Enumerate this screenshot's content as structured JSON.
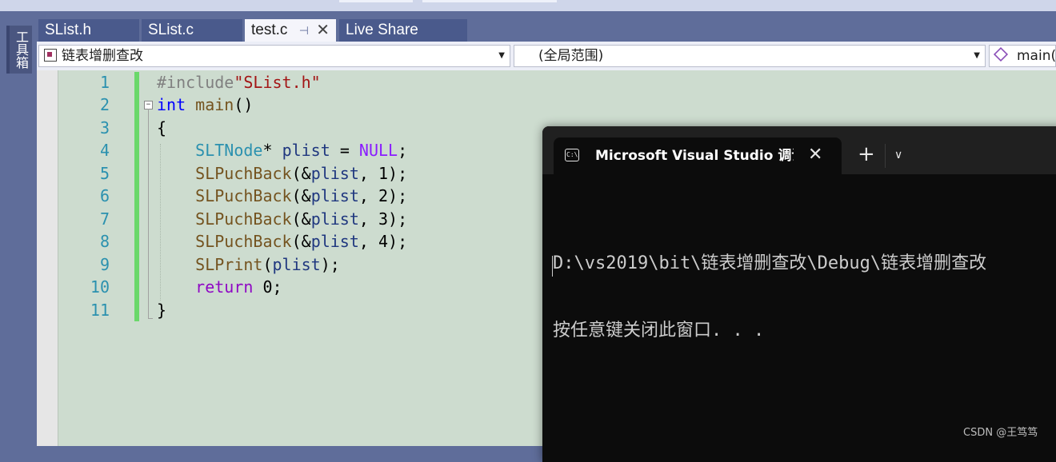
{
  "sidebar": {
    "toolbox_label": "工具箱"
  },
  "tabs": [
    {
      "label": "SList.h",
      "active": false
    },
    {
      "label": "SList.c",
      "active": false
    },
    {
      "label": "test.c",
      "active": true,
      "pin": "⊣",
      "close": "✕"
    },
    {
      "label": "Live Share",
      "active": false
    }
  ],
  "navbar": {
    "project": "链表增删查改",
    "scope": "(全局范围)",
    "member": "main()"
  },
  "editor": {
    "line_numbers": [
      "1",
      "2",
      "3",
      "4",
      "5",
      "6",
      "7",
      "8",
      "9",
      "10",
      "11"
    ],
    "code_lines": [
      "#include\"SList.h\"",
      "int main()",
      "{",
      "    SLTNode* plist = NULL;",
      "    SLPuchBack(&plist, 1);",
      "    SLPuchBack(&plist, 2);",
      "    SLPuchBack(&plist, 3);",
      "    SLPuchBack(&plist, 4);",
      "    SLPrint(plist);",
      "    return 0;",
      "}"
    ]
  },
  "console": {
    "tab_title": "Microsoft Visual Studio 调试控制台",
    "close": "✕",
    "new_tab": "+",
    "dropdown": "∨",
    "output": [
      "D:\\vs2019\\bit\\链表增删查改\\Debug\\链表增删查改",
      "按任意键关闭此窗口. . ."
    ]
  },
  "watermark": "CSDN @王笃笃"
}
